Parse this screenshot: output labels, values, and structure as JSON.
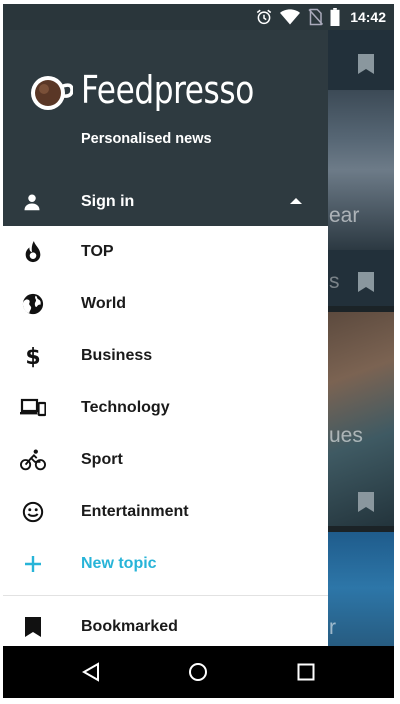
{
  "status_bar": {
    "time": "14:42",
    "icons": [
      "alarm-icon",
      "wifi-icon",
      "no-sim-icon",
      "battery-icon"
    ]
  },
  "drawer": {
    "app_name": "Feedpresso",
    "tagline": "Personalised news",
    "sign_in_label": "Sign in",
    "items": [
      {
        "label": "TOP",
        "icon": "flame-icon"
      },
      {
        "label": "World",
        "icon": "globe-icon"
      },
      {
        "label": "Business",
        "icon": "dollar-icon"
      },
      {
        "label": "Technology",
        "icon": "devices-icon"
      },
      {
        "label": "Sport",
        "icon": "bike-icon"
      },
      {
        "label": "Entertainment",
        "icon": "smiley-icon"
      },
      {
        "label": "New topic",
        "icon": "plus-icon"
      }
    ],
    "bookmarked_label": "Bookmarked"
  },
  "background": {
    "fragments": [
      "ear",
      "s",
      "ues",
      "r"
    ]
  },
  "colors": {
    "accent": "#27b4d8",
    "drawer_header": "#2e3a40",
    "status_bar": "#2a363b"
  }
}
